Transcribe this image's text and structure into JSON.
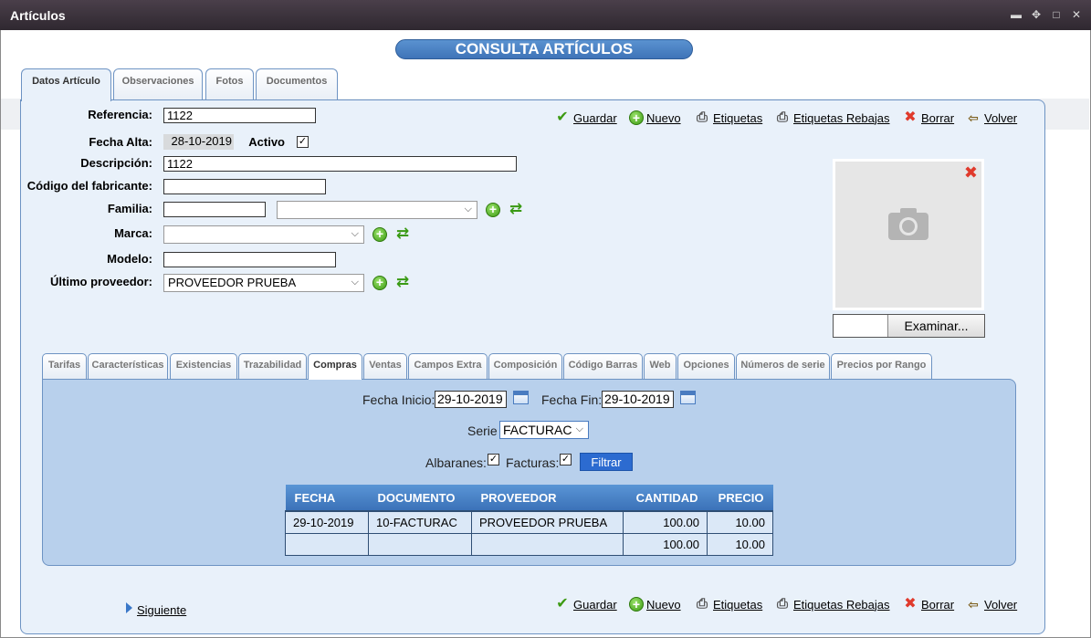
{
  "window": {
    "title": "Artículos",
    "controls": [
      "minimize",
      "move",
      "maximize",
      "close"
    ]
  },
  "banner": "CONSULTA ARTÍCULOS",
  "main_tabs": [
    "Datos Artículo",
    "Observaciones",
    "Fotos",
    "Documentos"
  ],
  "form": {
    "referencia_label": "Referencia:",
    "referencia_value": "1122",
    "fecha_alta_label": "Fecha Alta:",
    "fecha_alta_value": "28-10-2019",
    "activo_label": "Activo",
    "activo_checked": "✓",
    "descripcion_label": "Descripción:",
    "descripcion_value": "1122",
    "codigo_fabricante_label": "Código del fabricante:",
    "codigo_fabricante_value": "",
    "familia_label": "Familia:",
    "familia_value": "",
    "familia_select": "",
    "marca_label": "Marca:",
    "marca_select": "",
    "modelo_label": "Modelo:",
    "modelo_value": "",
    "ultimo_proveedor_label": "Último proveedor:",
    "ultimo_proveedor_select": "PROVEEDOR PRUEBA"
  },
  "actions": {
    "guardar": "Guardar",
    "nuevo": "Nuevo",
    "etiquetas": "Etiquetas",
    "etiquetas_rebajas": "Etiquetas Rebajas",
    "borrar": "Borrar",
    "volver": "Volver"
  },
  "photo": {
    "browse_button": "Examinar..."
  },
  "sub_tabs": [
    "Tarifas",
    "Características",
    "Existencias",
    "Trazabilidad",
    "Compras",
    "Ventas",
    "Campos Extra",
    "Composición",
    "Código Barras",
    "Web",
    "Opciones",
    "Números de serie",
    "Precios por Rango"
  ],
  "compras": {
    "fecha_inicio_label": "Fecha Inicio:",
    "fecha_inicio_value": "29-10-2019",
    "fecha_fin_label": "Fecha Fin:",
    "fecha_fin_value": "29-10-2019",
    "serie_label": "Serie",
    "serie_value": "FACTURAC",
    "albaranes_label": "Albaranes:",
    "facturas_label": "Facturas:",
    "check": "✓",
    "filtrar_button": "Filtrar",
    "table": {
      "headers": [
        "FECHA",
        "DOCUMENTO",
        "PROVEEDOR",
        "CANTIDAD",
        "PRECIO"
      ],
      "rows": [
        [
          "29-10-2019",
          "10-FACTURAC",
          "PROVEEDOR PRUEBA",
          "100.00",
          "10.00"
        ],
        [
          "",
          "",
          "",
          "100.00",
          "10.00"
        ]
      ]
    }
  },
  "footer": {
    "siguiente": "Siguiente"
  }
}
